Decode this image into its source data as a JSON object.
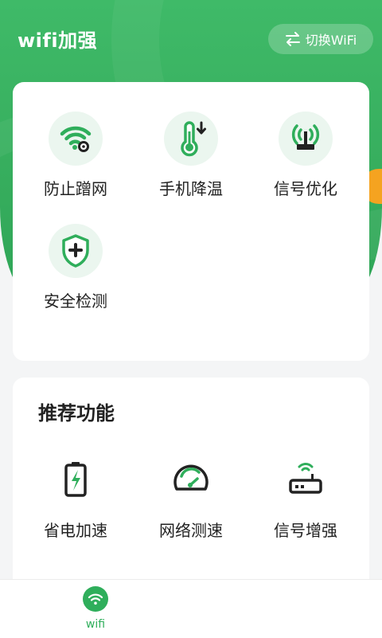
{
  "colors": {
    "brand": "#36ad5d",
    "accent_tab": "#f5a320",
    "icon_tint": "#ebf6ef"
  },
  "header": {
    "title": "wifi加强",
    "switch_button": {
      "label": "切换WiFi",
      "icon": "swap-arrows-icon"
    }
  },
  "tools": [
    {
      "label": "防止蹭网",
      "icon": "wifi-lock-icon"
    },
    {
      "label": "手机降温",
      "icon": "thermometer-icon"
    },
    {
      "label": "信号优化",
      "icon": "antenna-icon"
    },
    {
      "label": "安全检测",
      "icon": "shield-icon"
    }
  ],
  "recommend": {
    "title": "推荐功能",
    "items": [
      {
        "label": "省电加速",
        "icon": "battery-icon"
      },
      {
        "label": "网络测速",
        "icon": "speedometer-icon"
      },
      {
        "label": "信号增强",
        "icon": "router-icon"
      }
    ]
  },
  "tabbar": {
    "items": [
      {
        "label": "wifi",
        "icon": "wifi-icon",
        "active": true
      }
    ]
  }
}
